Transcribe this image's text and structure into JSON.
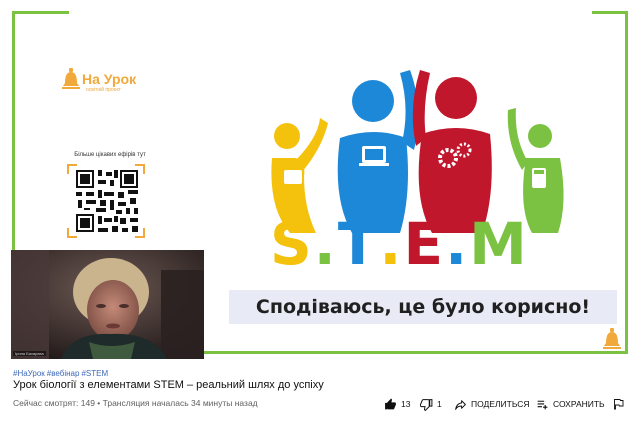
{
  "slide": {
    "logo": {
      "name": "На Урок",
      "subtitle": "освітній проект"
    },
    "qr_caption": "Більше цікавих ефірів тут",
    "stem_letters": [
      {
        "text": "S",
        "color": "#f4c20d"
      },
      {
        "text": ".",
        "color": "#7cc242"
      },
      {
        "text": "T",
        "color": "#1e88d8"
      },
      {
        "text": ".",
        "color": "#f4c20d"
      },
      {
        "text": "E",
        "color": "#c0172d"
      },
      {
        "text": ".",
        "color": "#1e88d8"
      },
      {
        "text": "M",
        "color": "#7cc242"
      }
    ],
    "banner_text": "Сподіваюсь, це було корисно!"
  },
  "webcam": {
    "name_tag": "Ірина Бахарєва"
  },
  "video": {
    "hashtags": [
      "#НаУрок",
      "#вебінар",
      "#STEM"
    ],
    "title": "Урок біології з елементами STEM – реальний шлях до успіху",
    "viewers": "Сейчас смотрят: 149 • Трансляция началась 34 минуты назад"
  },
  "actions": {
    "likes": "13",
    "dislikes": "1",
    "share_label": "ПОДЕЛИТЬСЯ",
    "save_label": "СОХРАНИТЬ"
  },
  "colors": {
    "frame": "#7cc242",
    "accent_orange": "#f0a93a",
    "link_blue": "#3e6ab8"
  }
}
